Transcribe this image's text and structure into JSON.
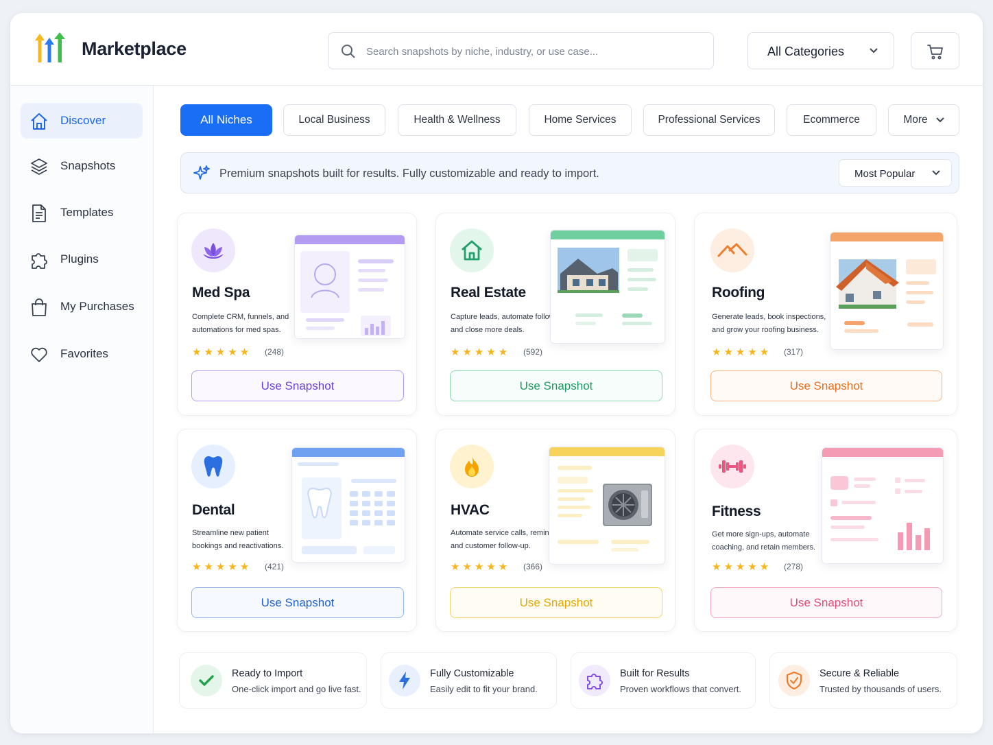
{
  "header": {
    "brand": "Marketplace",
    "search_placeholder": "Search snapshots by niche, industry, or use case...",
    "category_value": "All Categories"
  },
  "sidebar": {
    "items": [
      {
        "label": "Discover",
        "icon": "home-icon"
      },
      {
        "label": "Snapshots",
        "icon": "layers-icon"
      },
      {
        "label": "Templates",
        "icon": "document-icon"
      },
      {
        "label": "Plugins",
        "icon": "puzzle-icon"
      },
      {
        "label": "My Purchases",
        "icon": "shopping-bag-icon"
      },
      {
        "label": "Favorites",
        "icon": "heart-icon"
      }
    ]
  },
  "filters": {
    "chips": [
      "All Niches",
      "Local Business",
      "Health & Wellness",
      "Home Services",
      "Professional Services",
      "Ecommerce"
    ],
    "more_label": "More"
  },
  "banner": {
    "text": "Premium snapshots built for results. Fully customizable and ready to import.",
    "sort_value": "Most Popular"
  },
  "cards": [
    {
      "title": "Med Spa",
      "desc": "Complete CRM, funnels, and automations for med spas.",
      "stars": "★★★★★",
      "count": "(248)",
      "button": "Use Snapshot",
      "accent": "#7b4fe0",
      "icon": "lotus-icon"
    },
    {
      "title": "Real Estate",
      "desc": "Capture leads, automate follow-ups, and close more deals.",
      "stars": "★★★★★",
      "count": "(592)",
      "button": "Use Snapshot",
      "accent": "#22a06b",
      "icon": "house-icon"
    },
    {
      "title": "Roofing",
      "desc": "Generate leads, book inspections, and grow your roofing business.",
      "stars": "★★★★★",
      "count": "(317)",
      "button": "Use Snapshot",
      "accent": "#ef7d2b",
      "icon": "roof-icon"
    },
    {
      "title": "Dental",
      "desc": "Streamline new patient bookings and reactivations.",
      "stars": "★★★★★",
      "count": "(421)",
      "button": "Use Snapshot",
      "accent": "#2b6fe0",
      "icon": "tooth-icon"
    },
    {
      "title": "HVAC",
      "desc": "Automate service calls, reminders, and customer follow-up.",
      "stars": "★★★★★",
      "count": "(366)",
      "button": "Use Snapshot",
      "accent": "#f2b800",
      "icon": "flame-icon"
    },
    {
      "title": "Fitness",
      "desc": "Get more sign-ups, automate coaching, and retain members.",
      "stars": "★★★★★",
      "count": "(278)",
      "button": "Use Snapshot",
      "accent": "#e8577f",
      "icon": "dumbbell-icon"
    }
  ],
  "features": [
    {
      "title": "Ready to Import",
      "sub": "One-click import and go live fast.",
      "icon": "check-icon"
    },
    {
      "title": "Fully Customizable",
      "sub": "Easily edit to fit your brand.",
      "icon": "lightning-icon"
    },
    {
      "title": "Built for Results",
      "sub": "Proven workflows that convert.",
      "icon": "puzzle-icon"
    },
    {
      "title": "Secure & Reliable",
      "sub": "Trusted by thousands of users.",
      "icon": "shield-icon"
    }
  ]
}
